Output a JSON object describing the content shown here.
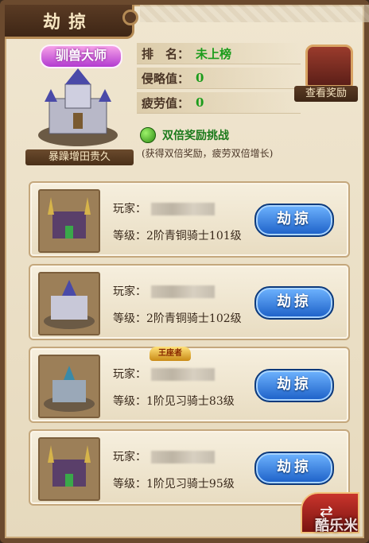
{
  "title": "劫掠",
  "profile": {
    "badge": "驯兽大师",
    "castle_name": "暴躁增田贵久"
  },
  "stats": [
    {
      "label": "排　名：",
      "value": "未上榜"
    },
    {
      "label": "侵略值：",
      "value": "0"
    },
    {
      "label": "疲劳值：",
      "value": "0"
    }
  ],
  "reward_button": "查看奖励",
  "double_reward": {
    "label": "双倍奖励挑战",
    "note": "(获得双倍奖励，疲劳双倍增长)"
  },
  "targets": [
    {
      "player_label": "玩家：",
      "level_label": "等级：",
      "level": "2阶青铜骑士101级",
      "action": "劫掠",
      "badge": ""
    },
    {
      "player_label": "玩家：",
      "level_label": "等级：",
      "level": "2阶青铜骑士102级",
      "action": "劫掠",
      "badge": ""
    },
    {
      "player_label": "玩家：",
      "level_label": "等级：",
      "level": "1阶见习骑士83级",
      "action": "劫掠",
      "badge": "王座者"
    },
    {
      "player_label": "玩家：",
      "level_label": "等级：",
      "level": "1阶见习骑士95级",
      "action": "劫掠",
      "badge": ""
    }
  ],
  "footer": {
    "watermark": "酷乐米"
  },
  "icons": {
    "back": "back-arrow-icon",
    "chest": "treasure-chest-icon"
  }
}
